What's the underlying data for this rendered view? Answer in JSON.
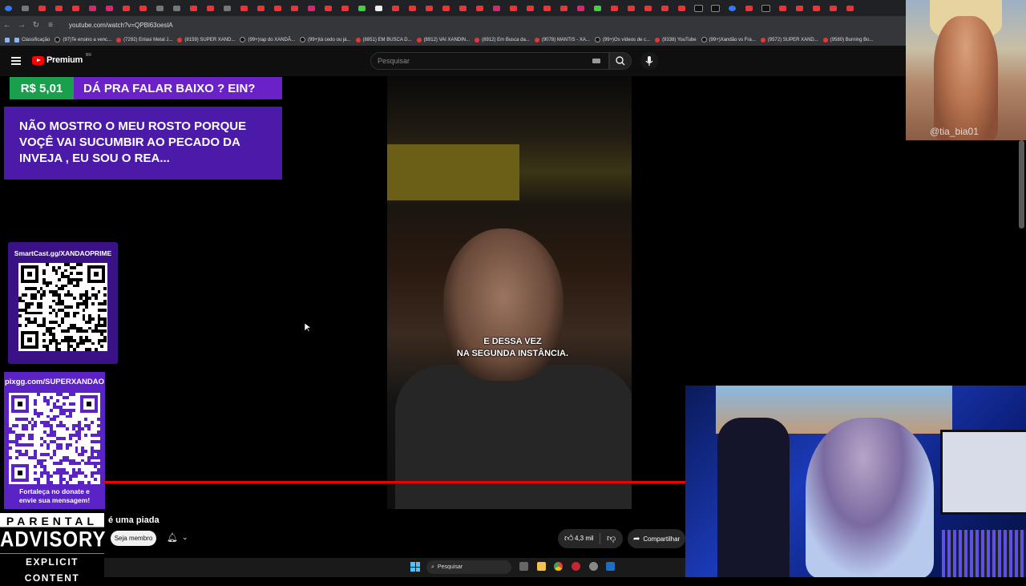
{
  "browser": {
    "url": "youtube.com/watch?v=QPBl63oeslA",
    "bookmarks": [
      {
        "label": "Classificação",
        "kind": "app"
      },
      {
        "label": "(97)Te ensino a venc...",
        "kind": "tk"
      },
      {
        "label": "(7292) Enlasi Metal J...",
        "kind": "yt"
      },
      {
        "label": "(8159) SUPER XAND...",
        "kind": "yt"
      },
      {
        "label": "(99+)rap do XANDÃ...",
        "kind": "tk"
      },
      {
        "label": "(99+)tá cedo ou já...",
        "kind": "tk"
      },
      {
        "label": "(8851) EM BUSCA D...",
        "kind": "yt"
      },
      {
        "label": "(8912) VAI XANDIN...",
        "kind": "yt"
      },
      {
        "label": "(8912) Em Busca da...",
        "kind": "yt"
      },
      {
        "label": "(9078) MANTIS - XA...",
        "kind": "yt"
      },
      {
        "label": "(99+)Os vídeos de c...",
        "kind": "tk"
      },
      {
        "label": "(9338) YouTube",
        "kind": "yt"
      },
      {
        "label": "(99+)Xandão vs Fra...",
        "kind": "tk"
      },
      {
        "label": "(9572) SUPER XAND...",
        "kind": "yt"
      },
      {
        "label": "(9580) Burning Bo...",
        "kind": "yt"
      }
    ]
  },
  "youtube": {
    "brand": "Premium",
    "region": "BR",
    "search_placeholder": "Pesquisar",
    "video_title": "é uma piada",
    "member_button": "Seja membro",
    "likes": "4,3 mil",
    "share": "Compartilhar",
    "progress": 1.0
  },
  "overlay": {
    "donation_amount": "R$ 5,01",
    "donation_question": "DÁ PRA FALAR BAIXO ? EIN?",
    "donation_message": "NÃO MOSTRO O MEU ROSTO PORQUE VOÇÊ VAI SUCUMBIR AO PECADO DA INVEJA , EU SOU O REA...",
    "qr1_label": "SmartCast.gg/XANDAOPRIME",
    "qr2_label": "pixgg.com/SUPERXANDAO",
    "qr2_footer_1": "Fortaleça no donate e",
    "qr2_footer_2": "envie sua mensagem!",
    "subtitle_line1": "E DESSA VEZ",
    "subtitle_line2": "NA SEGUNDA INSTÂNCIA.",
    "photo_watermark": "@tia_bia01"
  },
  "advisory": {
    "line1": "PARENTAL",
    "line2": "ADVISORY",
    "line3": "EXPLICIT CONTENT"
  },
  "taskbar": {
    "search": "Pesquisar"
  }
}
